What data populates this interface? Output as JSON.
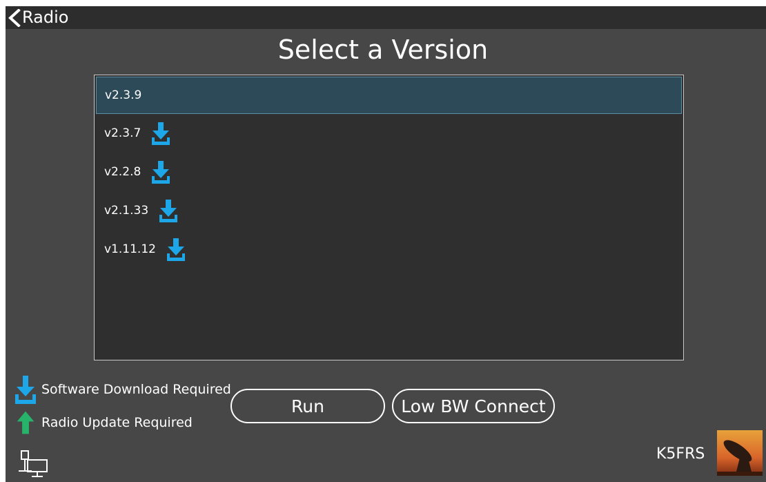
{
  "header": {
    "back_label": "Radio"
  },
  "title": "Select a Version",
  "versions": [
    {
      "label": "v2.3.9",
      "selected": true,
      "download_required": false
    },
    {
      "label": "v2.3.7",
      "selected": false,
      "download_required": true
    },
    {
      "label": "v2.2.8",
      "selected": false,
      "download_required": true
    },
    {
      "label": "v2.1.33",
      "selected": false,
      "download_required": true
    },
    {
      "label": "v1.11.12",
      "selected": false,
      "download_required": true
    }
  ],
  "legend": {
    "download": "Software Download Required",
    "update": "Radio Update Required"
  },
  "buttons": {
    "run": "Run",
    "low_bw": "Low BW Connect"
  },
  "footer": {
    "callsign": "K5FRS"
  },
  "colors": {
    "background": "#474747",
    "titlebar": "#2d2d2d",
    "list_bg": "#2f2f2f",
    "selected_bg": "#2d4a58",
    "download_icon": "#1ea7e8",
    "update_icon": "#27b46a"
  }
}
